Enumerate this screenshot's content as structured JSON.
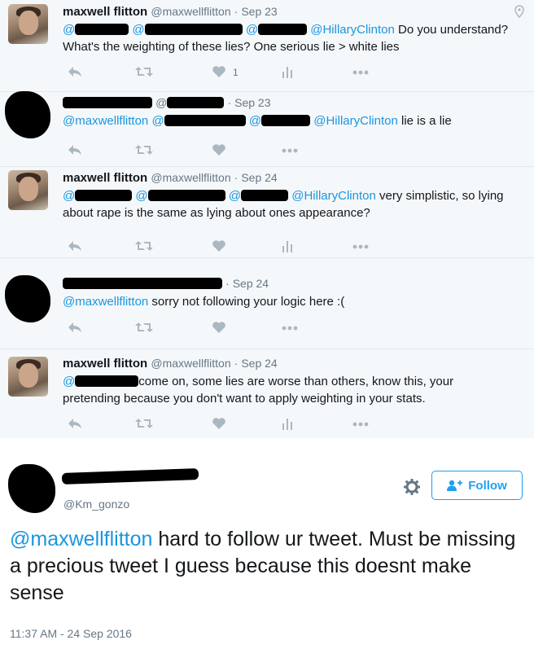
{
  "tweets": [
    {
      "name": "maxwell flitton",
      "handle": "@maxwellflitton",
      "date": "· Sep 23",
      "mention_prefix": "@",
      "mention_hc": "@HillaryClinton",
      "text_after": " Do you understand?",
      "line2": "What's the weighting of these lies? One serious lie > white lies",
      "like_count": "1"
    },
    {
      "date": "· Sep 23",
      "mention_mf": "@maxwellflitton",
      "mention_prefix": "@",
      "mention_hc": "@HillaryClinton",
      "text_after": " lie is a lie"
    },
    {
      "name": "maxwell flitton",
      "handle": "@maxwellflitton",
      "date": "· Sep 24",
      "mention_prefix": "@",
      "mention_hc": "@HillaryClinton",
      "text_after": " very simplistic, so lying",
      "line2": "about rape is the same as lying about ones appearance?"
    },
    {
      "date": "· Sep 24",
      "mention_mf": "@maxwellflitton",
      "text_after": " sorry not following your logic here :("
    },
    {
      "name": "maxwell flitton",
      "handle": "@maxwellflitton",
      "date": "· Sep 24",
      "mention_prefix": "@",
      "text_after": "come on, some lies are worse than others, know this, your",
      "line2": "pretending because you don't want to apply weighting in your stats."
    }
  ],
  "main": {
    "handle": "@Km_gonzo",
    "follow_label": "Follow",
    "mention": "@maxwellflitton",
    "text": " hard to follow ur tweet. Must be missing a precious tweet I guess because this doesnt make sense",
    "timestamp": "11:37 AM - 24 Sep 2016"
  },
  "icons": [
    "reply-icon",
    "retweet-icon",
    "like-icon",
    "analytics-icon",
    "more-icon",
    "location-pin-icon",
    "gear-icon",
    "follow-user-icon"
  ],
  "colors": {
    "link": "#1b95e0",
    "icon": "#aab8c2",
    "muted": "#657786",
    "follow": "#1da1f2"
  }
}
